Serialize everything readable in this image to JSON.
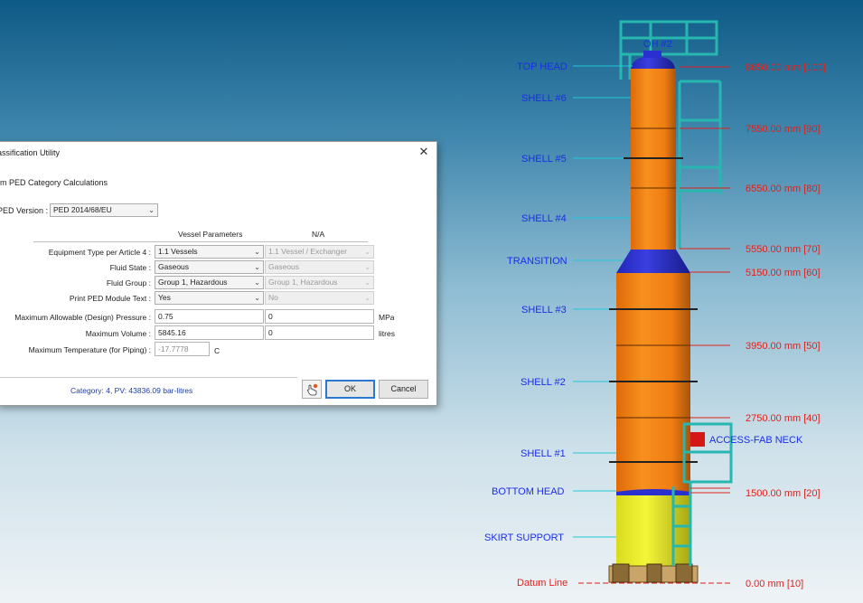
{
  "dialog": {
    "title": "assification Utility",
    "close_glyph": "✕",
    "subtitle": "rm PED Category Calculations",
    "ped_version_label": "PED Version :",
    "ped_version_value": "PED 2014/68/EU",
    "col_vessel": "Vessel Parameters",
    "col_na": "N/A",
    "rows": {
      "equipment_type": {
        "label": "Equipment Type per Article 4 :",
        "value": "1.1 Vessels",
        "na_value": "1.1 Vessel / Exchanger"
      },
      "fluid_state": {
        "label": "Fluid State :",
        "value": "Gaseous",
        "na_value": "Gaseous"
      },
      "fluid_group": {
        "label": "Fluid Group :",
        "value": "Group 1, Hazardous",
        "na_value": "Group 1, Hazardous"
      },
      "print_module": {
        "label": "Print PED Module Text :",
        "value": "Yes",
        "na_value": "No"
      },
      "max_pressure": {
        "label": "Maximum Allowable (Design) Pressure :",
        "value": "0.75",
        "na_value": "0",
        "unit": "MPa"
      },
      "max_volume": {
        "label": "Maximum Volume :",
        "value": "5845.16",
        "na_value": "0",
        "unit": "litres"
      },
      "max_temp": {
        "label": "Maximum Temperature (for Piping) :",
        "value": "-17.7778",
        "unit": "C"
      }
    },
    "status": "Category: 4,  PV: 43836.09 bar-litres",
    "ok_label": "OK",
    "cancel_label": "Cancel",
    "help_icon": "hand-help-icon"
  },
  "vessel": {
    "component_labels": {
      "oh2": "OH #2",
      "top_head": "TOP HEAD",
      "shell6": "SHELL #6",
      "shell5": "SHELL #5",
      "shell4": "SHELL #4",
      "transition": "TRANSITION",
      "shell3": "SHELL #3",
      "shell2": "SHELL #2",
      "access_neck": "ACCESS-FAB NECK",
      "shell1": "SHELL #1",
      "bottom_head": "BOTTOM HEAD",
      "skirt": "SKIRT SUPPORT",
      "datum": "Datum Line"
    },
    "elevations": {
      "e100": "8650.00 mm  [100]",
      "e90": "7550.00 mm  [90]",
      "e80": "6550.00 mm  [80]",
      "e70": "5550.00 mm  [70]",
      "e60": "5150.00 mm  [60]",
      "e50": "3950.00 mm  [50]",
      "e40": "2750.00 mm  [40]",
      "e20": "1500.00 mm  [20]",
      "e10": "0.00 mm  [10]"
    },
    "colors": {
      "shell": "#f07d12",
      "head": "#2a2fd0",
      "skirt": "#e8ec2a",
      "platform": "#27b7b0",
      "leader_blue": "#22c9d6",
      "leader_red": "#e0211c"
    }
  }
}
